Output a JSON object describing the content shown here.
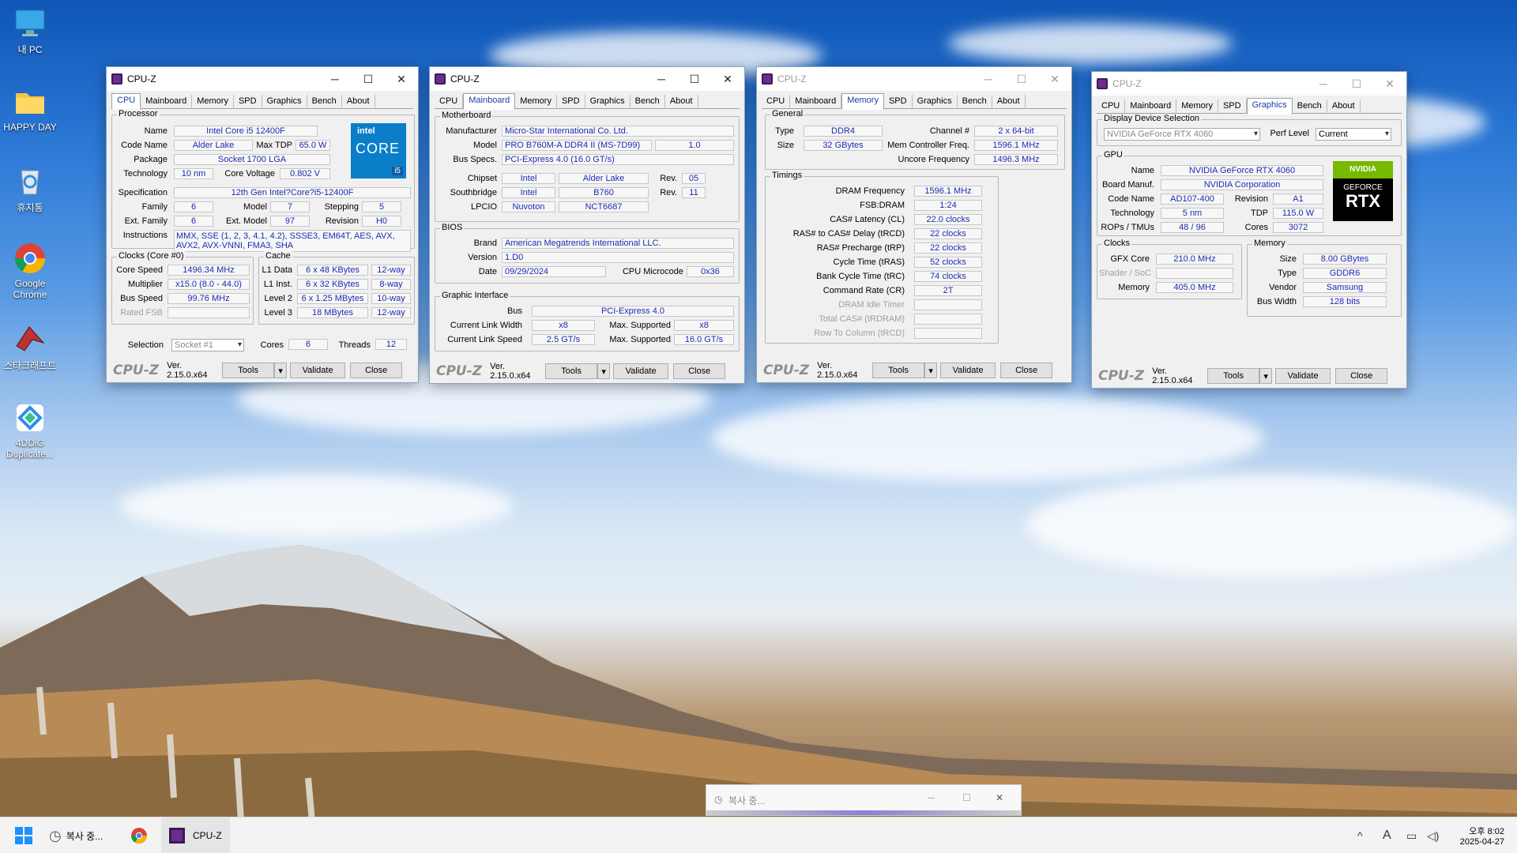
{
  "desktop": {
    "icons": [
      {
        "label": "내 PC",
        "icon": "monitor-icon"
      },
      {
        "label": "HAPPY DAY",
        "icon": "folder-icon"
      },
      {
        "label": "휴지통",
        "icon": "recycle-bin-icon"
      },
      {
        "label": "Google Chrome",
        "icon": "chrome-icon"
      },
      {
        "label": "스타크래프트",
        "icon": "starcraft-icon"
      },
      {
        "label": "4DDiG Duplicate...",
        "icon": "4ddig-icon"
      }
    ]
  },
  "common": {
    "app_title": "CPU-Z",
    "brand": "CPU-Z",
    "version": "Ver. 2.15.0.x64",
    "tools": "Tools",
    "validate": "Validate",
    "close": "Close",
    "tabs": [
      "CPU",
      "Mainboard",
      "Memory",
      "SPD",
      "Graphics",
      "Bench",
      "About"
    ]
  },
  "cpu": {
    "g_processor": "Processor",
    "l_name": "Name",
    "name": "Intel Core i5 12400F",
    "l_codename": "Code Name",
    "codename": "Alder Lake",
    "l_maxtdp": "Max TDP",
    "maxtdp": "65.0 W",
    "l_package": "Package",
    "package": "Socket 1700 LGA",
    "l_tech": "Technology",
    "tech": "10 nm",
    "l_corev": "Core Voltage",
    "corev": "0.802 V",
    "l_spec": "Specification",
    "spec": "12th Gen Intel?Core?i5-12400F",
    "l_family": "Family",
    "family": "6",
    "l_model": "Model",
    "model": "7",
    "l_stepping": "Stepping",
    "stepping": "5",
    "l_extfamily": "Ext. Family",
    "extfamily": "6",
    "l_extmodel": "Ext. Model",
    "extmodel": "97",
    "l_revision": "Revision",
    "revision": "H0",
    "l_instr": "Instructions",
    "instr": "MMX, SSE (1, 2, 3, 4.1, 4.2), SSSE3, EM64T, AES, AVX, AVX2, AVX-VNNI, FMA3, SHA",
    "g_clocks": "Clocks (Core #0)",
    "l_corespeed": "Core Speed",
    "corespeed": "1496.34 MHz",
    "l_mult": "Multiplier",
    "mult": "x15.0 (8.0 - 44.0)",
    "l_bus": "Bus Speed",
    "bus": "99.76 MHz",
    "l_ratedfsb": "Rated FSB",
    "g_cache": "Cache",
    "l_l1d": "L1 Data",
    "l1d": "6 x 48 KBytes",
    "l1d_w": "12-way",
    "l_l1i": "L1 Inst.",
    "l1i": "6 x 32 KBytes",
    "l1i_w": "8-way",
    "l_l2": "Level 2",
    "l2": "6 x 1.25 MBytes",
    "l2_w": "10-way",
    "l_l3": "Level 3",
    "l3": "18 MBytes",
    "l3_w": "12-way",
    "l_selection": "Selection",
    "selection": "Socket #1",
    "l_cores": "Cores",
    "cores": "6",
    "l_threads": "Threads",
    "threads": "12",
    "logo_top": "intel",
    "logo_mid": "CORE",
    "logo_badge": "i5"
  },
  "mb": {
    "g_mb": "Motherboard",
    "l_manu": "Manufacturer",
    "manu": "Micro-Star International Co. Ltd.",
    "l_model": "Model",
    "model": "PRO B760M-A DDR4 II (MS-7D99)",
    "model_rev": "1.0",
    "l_busspecs": "Bus Specs.",
    "busspecs": "PCI-Express 4.0 (16.0 GT/s)",
    "l_chipset": "Chipset",
    "chipset": "Intel",
    "chipset2": "Alder Lake",
    "l_rev": "Rev.",
    "chipset_rev": "05",
    "l_south": "Southbridge",
    "south": "Intel",
    "south2": "B760",
    "south_rev": "11",
    "l_lpcio": "LPCIO",
    "lpcio": "Nuvoton",
    "lpcio2": "NCT6687",
    "g_bios": "BIOS",
    "l_brand": "Brand",
    "brand": "American Megatrends International LLC.",
    "l_version": "Version",
    "version": "1.D0",
    "l_date": "Date",
    "date": "09/29/2024",
    "l_micro": "CPU Microcode",
    "micro": "0x36",
    "g_gi": "Graphic Interface",
    "l_gbus": "Bus",
    "gbus": "PCI-Express 4.0",
    "l_clw": "Current Link Width",
    "clw": "x8",
    "l_msw": "Max. Supported",
    "msw": "x8",
    "l_cls": "Current Link Speed",
    "cls": "2.5 GT/s",
    "mss": "16.0 GT/s"
  },
  "mem": {
    "g_general": "General",
    "l_type": "Type",
    "type": "DDR4",
    "l_channel": "Channel #",
    "channel": "2 x 64-bit",
    "l_size": "Size",
    "size": "32 GBytes",
    "l_mcf": "Mem Controller Freq.",
    "mcf": "1596.1 MHz",
    "l_uncore": "Uncore Frequency",
    "uncore": "1496.3 MHz",
    "g_timings": "Timings",
    "rows": [
      {
        "label": "DRAM Frequency",
        "value": "1596.1 MHz",
        "dim": false
      },
      {
        "label": "FSB:DRAM",
        "value": "1:24",
        "dim": false
      },
      {
        "label": "CAS# Latency (CL)",
        "value": "22.0 clocks",
        "dim": false
      },
      {
        "label": "RAS# to CAS# Delay (tRCD)",
        "value": "22 clocks",
        "dim": false
      },
      {
        "label": "RAS# Precharge (tRP)",
        "value": "22 clocks",
        "dim": false
      },
      {
        "label": "Cycle Time (tRAS)",
        "value": "52 clocks",
        "dim": false
      },
      {
        "label": "Bank Cycle Time (tRC)",
        "value": "74 clocks",
        "dim": false
      },
      {
        "label": "Command Rate (CR)",
        "value": "2T",
        "dim": false
      },
      {
        "label": "DRAM Idle Timer",
        "value": "",
        "dim": true
      },
      {
        "label": "Total CAS# (tRDRAM)",
        "value": "",
        "dim": true
      },
      {
        "label": "Row To Column (tRCD)",
        "value": "",
        "dim": true
      }
    ]
  },
  "gfx": {
    "g_dds": "Display Device Selection",
    "device": "NVIDIA GeForce RTX 4060",
    "l_perf": "Perf Level",
    "perf": "Current",
    "g_gpu": "GPU",
    "l_name": "Name",
    "name": "NVIDIA GeForce RTX 4060",
    "l_board": "Board Manuf.",
    "board": "NVIDIA Corporation",
    "l_code": "Code Name",
    "code": "AD107-400",
    "l_rev": "Revision",
    "rev": "A1",
    "l_tech": "Technology",
    "tech": "5 nm",
    "l_tdp": "TDP",
    "tdp": "115.0 W",
    "l_rops": "ROPs / TMUs",
    "rops": "48 / 96",
    "l_cores": "Cores",
    "cores": "3072",
    "g_clocks": "Clocks",
    "l_gfxcore": "GFX Core",
    "gfxcore": "210.0 MHz",
    "l_shader": "Shader / SoC",
    "l_memory": "Memory",
    "memory": "405.0 MHz",
    "g_memory": "Memory",
    "l_size": "Size",
    "size": "8.00 GBytes",
    "l_type": "Type",
    "type": "GDDR6",
    "l_vendor": "Vendor",
    "vendor": "Samsung",
    "l_buswidth": "Bus Width",
    "buswidth": "128 bits",
    "logo_top": "NVIDIA",
    "logo_mid": "GEFORCE",
    "logo_big": "RTX"
  },
  "copy_dialog": {
    "title": "복사 중..."
  },
  "taskbar": {
    "item_copy": "복사 중...",
    "item_cpuz": "CPU-Z",
    "time": "오후 8:02",
    "date": "2025-04-27",
    "ime": "A"
  }
}
